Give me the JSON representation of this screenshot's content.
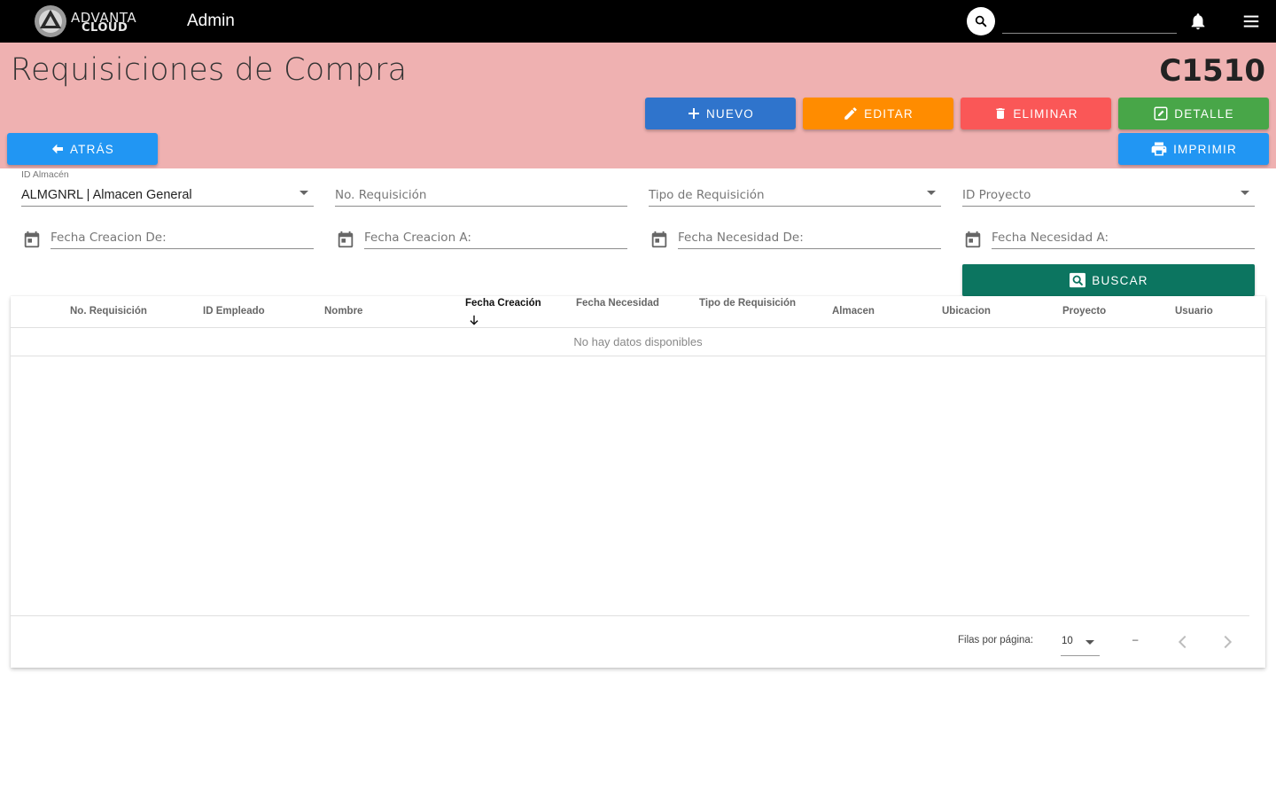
{
  "topbar": {
    "logo_line1": "ADVANTA",
    "logo_line2": "CLOUD",
    "section": "Admin",
    "search_placeholder": "",
    "icons": [
      "search-icon",
      "bell-icon",
      "menu-icon"
    ]
  },
  "header": {
    "title": "Requisiciones de Compra",
    "code": "C1510"
  },
  "actions": {
    "nuevo": "NUEVO",
    "editar": "EDITAR",
    "eliminar": "ELIMINAR",
    "detalle": "DETALLE",
    "atras": "ATRÁS",
    "imprimir": "IMPRIMIR",
    "buscar": "BUSCAR"
  },
  "colors": {
    "header_band": "#efb1b1",
    "nuevo": "#2f74cc",
    "editar": "#ff8c00",
    "eliminar": "#fa5757",
    "detalle": "#48a648",
    "atras": "#2196f3",
    "imprimir": "#2196f3",
    "buscar": "#0c7560"
  },
  "filters": {
    "almacen": {
      "label": "ID Almacén",
      "value": "ALMGNRL | Almacen General"
    },
    "no_requisicion": {
      "placeholder": "No. Requisición"
    },
    "tipo_requisicion": {
      "placeholder": "Tipo de Requisición"
    },
    "id_proyecto": {
      "placeholder": "ID Proyecto"
    },
    "fecha_creacion_de": {
      "placeholder": "Fecha Creacion De:"
    },
    "fecha_creacion_a": {
      "placeholder": "Fecha Creacion A:"
    },
    "fecha_necesidad_de": {
      "placeholder": "Fecha Necesidad De:"
    },
    "fecha_necesidad_a": {
      "placeholder": "Fecha Necesidad A:"
    }
  },
  "table": {
    "columns": [
      "No. Requisición",
      "ID Empleado",
      "Nombre",
      "Fecha Creación",
      "Fecha Necesidad",
      "Tipo de Requisición",
      "Almacen",
      "Ubicacion",
      "Proyecto",
      "Usuario"
    ],
    "sorted_column": "Fecha Creación",
    "sort_direction": "descending",
    "rows": [],
    "empty_message": "No hay datos disponibles"
  },
  "pagination": {
    "rows_per_page_label": "Filas por página:",
    "rows_per_page": "10",
    "range": "–"
  }
}
